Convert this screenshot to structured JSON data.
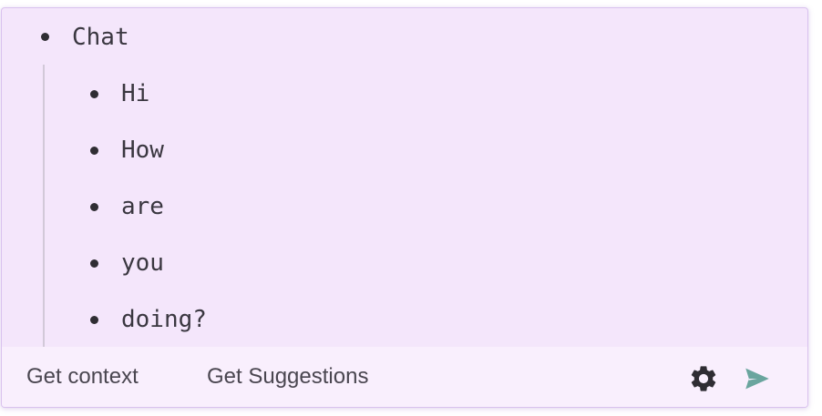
{
  "outline": {
    "root": {
      "label": "Chat",
      "children": [
        {
          "label": "Hi"
        },
        {
          "label": "How"
        },
        {
          "label": "are"
        },
        {
          "label": "you"
        },
        {
          "label": "doing?"
        }
      ]
    }
  },
  "footer": {
    "get_context_label": "Get context",
    "get_suggestions_label": "Get Suggestions",
    "settings_icon": "gear-icon",
    "send_icon": "send-icon"
  },
  "colors": {
    "card_background": "#f4e6fb",
    "footer_background": "#f9effd",
    "send_accent": "#6aa59e",
    "gear": "#2f2d33"
  }
}
